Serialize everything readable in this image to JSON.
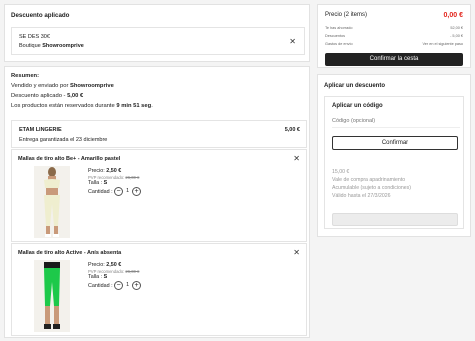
{
  "discount": {
    "heading": "Descuento aplicado",
    "code": "SE DES 30€",
    "shop_prefix": "Boutique ",
    "shop": "Showroomprive"
  },
  "summary": {
    "heading": "Resumen:",
    "sold_by_prefix": "Vendido y enviado por ",
    "sold_by": "Showroomprive",
    "discount_prefix": "Descuento aplicado - ",
    "discount_value": "5,00 €",
    "reserved_prefix": "Los productos están reservados durante ",
    "reserved_time": "9 min 51 seg",
    "reserved_suffix": ".",
    "shop_name": "ETAM LINGERIE",
    "shop_price": "5,00 €",
    "delivery": "Entrega garantizada el 23 diciembre",
    "items": [
      {
        "name": "Mallas de tiro alto Be+ - Amarillo pastel",
        "price_label": "Precio: ",
        "price": "2,50 €",
        "rrp_label": "PVP recomendado: ",
        "rrp": "26,00 €",
        "size_label": "Talla : ",
        "size": "S",
        "qty_label": "Cantidad : ",
        "qty": "1",
        "color": "#efeecf"
      },
      {
        "name": "Mallas de tiro alto Active - Anís absenta",
        "price_label": "Precio: ",
        "price": "2,50 €",
        "rrp_label": "PVP recomendado: ",
        "rrp": "26,00 €",
        "size_label": "Talla : ",
        "size": "S",
        "qty_label": "Cantidad : ",
        "qty": "1",
        "color": "#1dc94a"
      }
    ]
  },
  "totals": {
    "price_label": "Precio (2 items)",
    "price_value": "0,00 €",
    "rows": [
      {
        "label": "Te has ahorrado",
        "value": "52,00 €"
      },
      {
        "label": "Descuentos",
        "value": "- 5,00 €"
      },
      {
        "label": "Gastos de envío",
        "value": "Ver en el siguiente paso"
      }
    ],
    "confirm": "Confirmar la cesta"
  },
  "apply": {
    "heading": "Aplicar un descuento",
    "code_heading": "Aplicar un código",
    "placeholder": "Código (opcional)",
    "confirm": "Confirmar",
    "voucher_amount": "15,00 €",
    "voucher_line1": "Vale de compra apadrinamiento",
    "voucher_line2": "Acumulable (sujeto a condiciones)",
    "voucher_line3": "Válido hasta el 27/3/2026"
  },
  "icons": {
    "close": "close-icon",
    "minus": "minus-icon",
    "plus": "plus-icon"
  },
  "colors": {
    "accent_price": "#e2231a",
    "dark_button": "#222222"
  }
}
